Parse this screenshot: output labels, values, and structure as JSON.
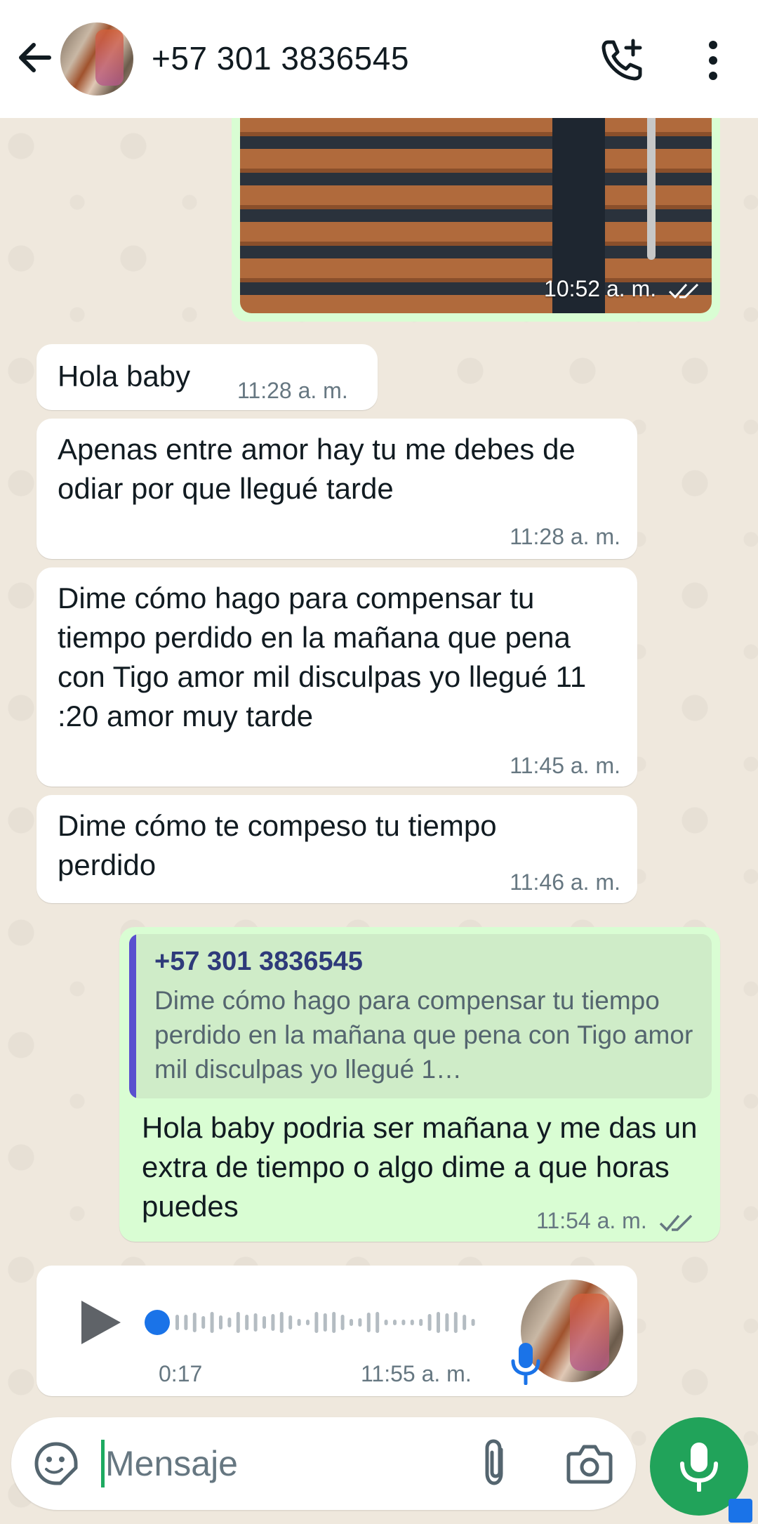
{
  "header": {
    "contact": "+57 301 3836545"
  },
  "messages": {
    "image_time": "10:52 a. m.",
    "m1_text": "Hola baby",
    "m1_time": "11:28 a. m.",
    "m2_text": "Apenas entre amor hay tu me debes de odiar por que llegué tarde",
    "m2_time": "11:28 a. m.",
    "m3_text": "Dime cómo hago para compensar tu tiempo perdido en la mañana  que pena con Tigo amor mil disculpas yo llegué 11 :20 amor muy tarde",
    "m3_time": "11:45 a. m.",
    "m4_text": "Dime cómo te compeso tu tiempo perdido",
    "m4_time": "11:46 a. m.",
    "reply": {
      "quoted_name": "+57 301 3836545",
      "quoted_text": "Dime cómo hago para compensar tu tiempo perdido en la mañana  que pena con Tigo amor mil disculpas yo llegué 1…",
      "text": "Hola baby podria ser mañana y me das un extra de tiempo o algo dime a que horas puedes",
      "time": "11:54 a. m."
    },
    "voice": {
      "duration": "0:17",
      "time": "11:55 a. m."
    }
  },
  "composer": {
    "placeholder": "Mensaje"
  },
  "colors": {
    "outgoing": "#d9fdd3",
    "incoming": "#ffffff",
    "accent_green": "#21a35a",
    "read_ticks": "#667781"
  }
}
